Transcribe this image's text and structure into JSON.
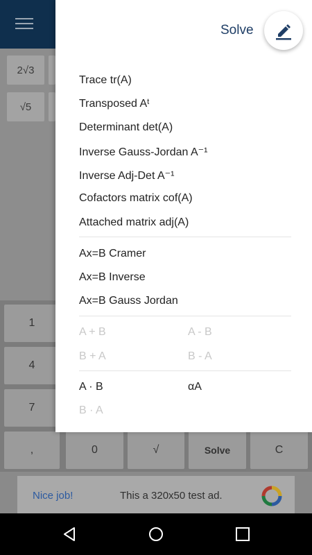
{
  "background": {
    "top_keys": [
      "2√3",
      "√5"
    ],
    "keypad_rows": [
      [
        "1",
        ""
      ],
      [
        "4",
        ""
      ],
      [
        "7",
        ""
      ],
      [
        ",",
        "0",
        "√",
        "Solve",
        "C"
      ]
    ]
  },
  "menu": {
    "header_title": "Solve",
    "items": [
      {
        "label": "Trace  tr(A)"
      },
      {
        "label": "Transposed Aᵗ"
      },
      {
        "label": "Determinant  det(A)"
      },
      {
        "label": "Inverse Gauss-Jordan  A⁻¹"
      },
      {
        "label": "Inverse Adj-Det  A⁻¹"
      },
      {
        "label": "Cofactors matrix  cof(A)"
      },
      {
        "label": "Attached matrix  adj(A)"
      }
    ],
    "system_items": [
      {
        "label": "Ax=B Cramer"
      },
      {
        "label": "Ax=B Inverse"
      },
      {
        "label": "Ax=B Gauss Jordan"
      }
    ],
    "binary_ops": {
      "col1": [
        "A + B",
        "B + A"
      ],
      "col2": [
        "A - B",
        "B - A"
      ]
    },
    "product_ops": {
      "col1": [
        "A · B",
        "B · A"
      ],
      "col2": [
        "αA"
      ]
    }
  },
  "ad": {
    "nice": "Nice job!",
    "text": "This a 320x50 test ad."
  },
  "colors": {
    "appbar": "#0f2f4d",
    "accent": "#1f3e66",
    "disabled": "#c8c8c8"
  }
}
